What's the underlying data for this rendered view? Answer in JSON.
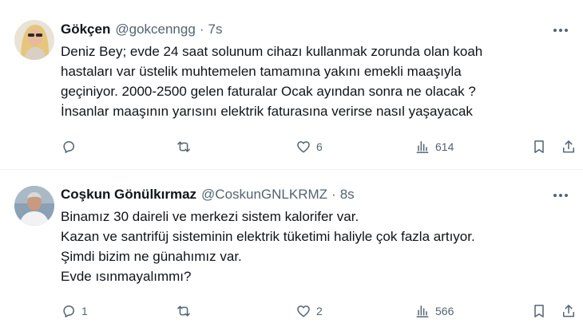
{
  "tweets": [
    {
      "name": "Gökçen",
      "handle": "@gokcenngg",
      "separator": "·",
      "time": "7s",
      "lines": [
        "Deniz Bey; evde 24 saat solunum cihazı kullanmak zorunda olan koah",
        "hastaları var üstelik muhtemelen tamamına yakını emekli maaşıyla",
        "geçiniyor. 2000-2500 gelen faturalar Ocak ayından sonra ne olacak ?",
        "İnsanlar maaşının yarısını elektrik faturasına verirse nasıl yaşayacak"
      ],
      "replies": "",
      "retweets": "",
      "likes": "6",
      "views": "614"
    },
    {
      "name": "Coşkun Gönülkırmaz",
      "handle": "@CoskunGNLKRMZ",
      "separator": "·",
      "time": "8s",
      "lines": [
        "Binamız 30 daireli ve merkezi sistem kalorifer var.",
        "Kazan ve santrifüj sisteminin elektrik tüketimi haliyle çok fazla artıyor.",
        "Şimdi bizim ne günahımız var.",
        "Evde ısınmayalımmı?"
      ],
      "replies": "1",
      "retweets": "",
      "likes": "2",
      "views": "566"
    }
  ],
  "icons": {
    "reply": "reply-icon",
    "retweet": "retweet-icon",
    "like": "heart-icon",
    "views": "views-icon",
    "bookmark": "bookmark-icon",
    "share": "share-icon",
    "more": "more-icon"
  },
  "colors": {
    "text": "#0f1419",
    "secondary": "#536471",
    "divider": "#eff3f4"
  }
}
